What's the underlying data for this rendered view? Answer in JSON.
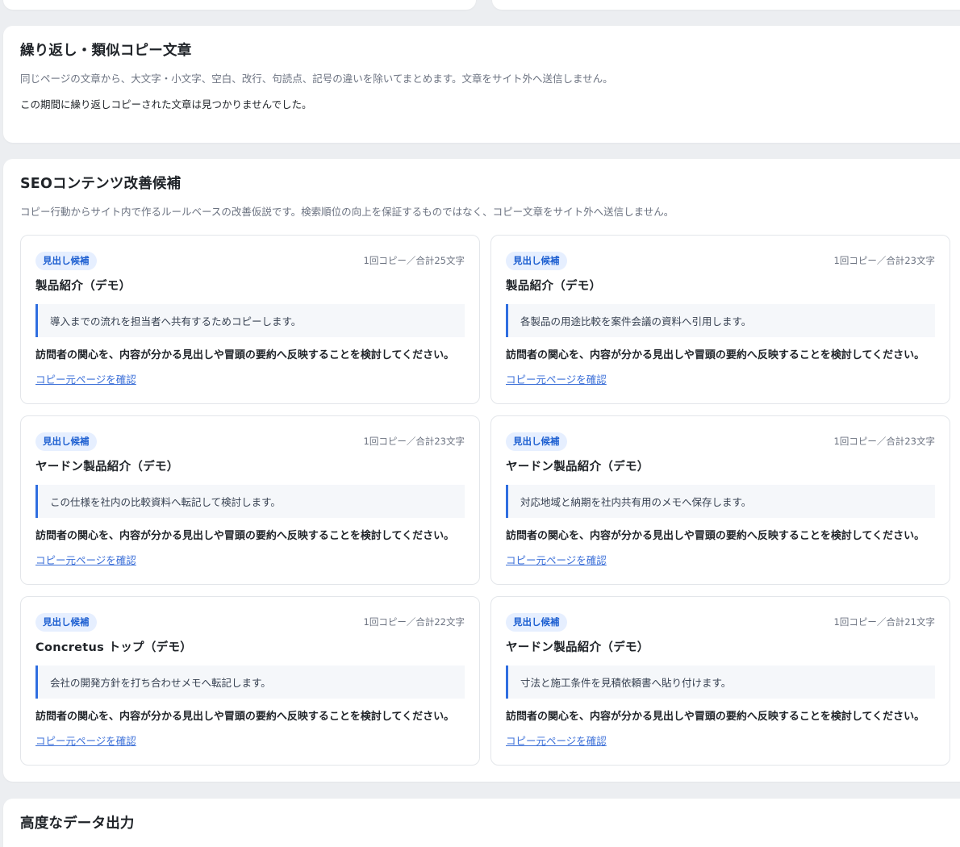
{
  "repeat_section": {
    "title": "繰り返し・類似コピー文章",
    "description": "同じページの文章から、大文字・小文字、空白、改行、句読点、記号の違いを除いてまとめます。文章をサイト外へ送信しません。",
    "note": "この期間に繰り返しコピーされた文章は見つかりませんでした。"
  },
  "seo_section": {
    "title": "SEOコンテンツ改善候補",
    "description": "コピー行動からサイト内で作るルールベースの改善仮説です。検索順位の向上を保証するものではなく、コピー文章をサイト外へ送信しません。",
    "cards": [
      {
        "badge": "見出し候補",
        "meta": "1回コピー／合計25文字",
        "title": "製品紹介（デモ）",
        "quote": "導入までの流れを担当者へ共有するためコピーします。",
        "advice": "訪問者の関心を、内容が分かる見出しや冒頭の要約へ反映することを検討してください。",
        "link": "コピー元ページを確認"
      },
      {
        "badge": "見出し候補",
        "meta": "1回コピー／合計23文字",
        "title": "製品紹介（デモ）",
        "quote": "各製品の用途比較を案件会議の資料へ引用します。",
        "advice": "訪問者の関心を、内容が分かる見出しや冒頭の要約へ反映することを検討してください。",
        "link": "コピー元ページを確認"
      },
      {
        "badge": "見出し候補",
        "meta": "1回コピー／合計23文字",
        "title": "ヤードン製品紹介（デモ）",
        "quote": "この仕様を社内の比較資料へ転記して検討します。",
        "advice": "訪問者の関心を、内容が分かる見出しや冒頭の要約へ反映することを検討してください。",
        "link": "コピー元ページを確認"
      },
      {
        "badge": "見出し候補",
        "meta": "1回コピー／合計23文字",
        "title": "ヤードン製品紹介（デモ）",
        "quote": "対応地域と納期を社内共有用のメモへ保存します。",
        "advice": "訪問者の関心を、内容が分かる見出しや冒頭の要約へ反映することを検討してください。",
        "link": "コピー元ページを確認"
      },
      {
        "badge": "見出し候補",
        "meta": "1回コピー／合計22文字",
        "title": "Concretus トップ（デモ）",
        "quote": "会社の開発方針を打ち合わせメモへ転記します。",
        "advice": "訪問者の関心を、内容が分かる見出しや冒頭の要約へ反映することを検討してください。",
        "link": "コピー元ページを確認"
      },
      {
        "badge": "見出し候補",
        "meta": "1回コピー／合計21文字",
        "title": "ヤードン製品紹介（デモ）",
        "quote": "寸法と施工条件を見積依頼書へ貼り付けます。",
        "advice": "訪問者の関心を、内容が分かる見出しや冒頭の要約へ反映することを検討してください。",
        "link": "コピー元ページを確認"
      }
    ]
  },
  "export_section": {
    "title": "高度なデータ出力"
  },
  "colors": {
    "badge_bg": "#e6efff",
    "badge_text": "#1d5fd1",
    "quote_border": "#2f6ee0",
    "link": "#3b6fd8"
  }
}
